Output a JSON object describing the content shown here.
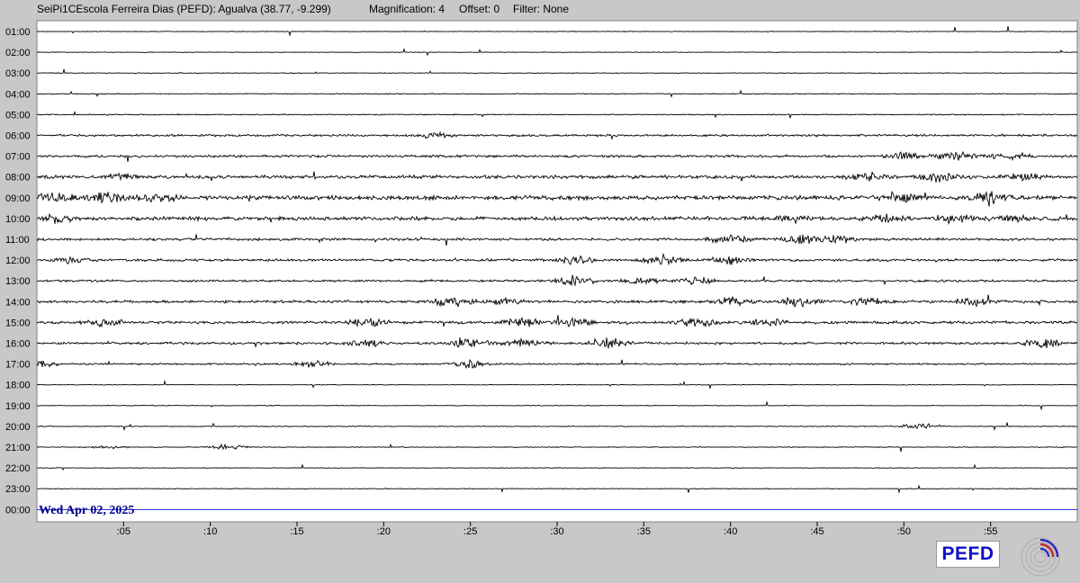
{
  "header": {
    "station": "SeiPi1CEscola Ferreira Dias (PEFD):  Agualva (38.77, -9.299)",
    "magnification": "Magnification: 4",
    "offset": "Offset: 0",
    "filter": "Filter: None"
  },
  "date_label": "Wed Apr 02, 2025",
  "logo": {
    "text": "PEFD",
    "icon": "seismograph-logo-icon",
    "color": "#1010c8"
  },
  "colors": {
    "background": "#c8c8c8",
    "plot": "#ffffff",
    "trace": "#000000",
    "last_trace": "#0000cc",
    "date": "#00008b"
  },
  "chart_data": {
    "type": "helicorder",
    "hours": [
      "01:00",
      "02:00",
      "03:00",
      "04:00",
      "05:00",
      "06:00",
      "07:00",
      "08:00",
      "09:00",
      "10:00",
      "11:00",
      "12:00",
      "13:00",
      "14:00",
      "15:00",
      "16:00",
      "17:00",
      "18:00",
      "19:00",
      "20:00",
      "21:00",
      "22:00",
      "23:00",
      "00:00"
    ],
    "minute_ticks": [
      ":05",
      ":10",
      ":15",
      ":20",
      ":25",
      ":30",
      ":35",
      ":40",
      ":45",
      ":50",
      ":55"
    ],
    "minute_tick_values": [
      5,
      10,
      15,
      20,
      25,
      30,
      35,
      40,
      45,
      50,
      55
    ],
    "xlim": [
      0,
      60
    ],
    "activity": [
      {
        "hour": "01:00",
        "base": 0.3,
        "bursts": []
      },
      {
        "hour": "02:00",
        "base": 0.3,
        "bursts": []
      },
      {
        "hour": "03:00",
        "base": 0.3,
        "bursts": []
      },
      {
        "hour": "04:00",
        "base": 0.4,
        "bursts": []
      },
      {
        "hour": "05:00",
        "base": 0.5,
        "bursts": []
      },
      {
        "hour": "06:00",
        "base": 1.0,
        "bursts": [
          [
            23,
            3
          ]
        ]
      },
      {
        "hour": "07:00",
        "base": 1.2,
        "bursts": [
          [
            50,
            4
          ],
          [
            53,
            5
          ],
          [
            56,
            4
          ]
        ]
      },
      {
        "hour": "08:00",
        "base": 1.6,
        "bursts": [
          [
            5,
            3
          ],
          [
            48,
            4
          ],
          [
            52,
            5
          ],
          [
            57,
            4
          ]
        ]
      },
      {
        "hour": "09:00",
        "base": 2.0,
        "bursts": [
          [
            1,
            6
          ],
          [
            4,
            6
          ],
          [
            7,
            5
          ],
          [
            50,
            5
          ],
          [
            55,
            6
          ]
        ]
      },
      {
        "hour": "10:00",
        "base": 1.8,
        "bursts": [
          [
            1,
            5
          ],
          [
            44,
            4
          ],
          [
            49,
            5
          ],
          [
            53,
            5
          ],
          [
            56,
            4
          ]
        ]
      },
      {
        "hour": "11:00",
        "base": 1.2,
        "bursts": [
          [
            40,
            4
          ],
          [
            44,
            5
          ],
          [
            46,
            4
          ]
        ]
      },
      {
        "hour": "12:00",
        "base": 1.2,
        "bursts": [
          [
            2,
            3
          ],
          [
            31,
            5
          ],
          [
            36,
            5
          ],
          [
            40,
            4
          ]
        ]
      },
      {
        "hour": "13:00",
        "base": 1.0,
        "bursts": [
          [
            31,
            5
          ],
          [
            35,
            4
          ],
          [
            38,
            4
          ]
        ]
      },
      {
        "hour": "14:00",
        "base": 1.3,
        "bursts": [
          [
            24,
            5
          ],
          [
            27,
            4
          ],
          [
            40,
            5
          ],
          [
            44,
            5
          ],
          [
            48,
            4
          ],
          [
            54,
            5
          ]
        ]
      },
      {
        "hour": "15:00",
        "base": 1.3,
        "bursts": [
          [
            4,
            4
          ],
          [
            19,
            5
          ],
          [
            28,
            5
          ],
          [
            31,
            5
          ],
          [
            38,
            5
          ],
          [
            42,
            5
          ]
        ]
      },
      {
        "hour": "16:00",
        "base": 1.2,
        "bursts": [
          [
            19,
            4
          ],
          [
            25,
            5
          ],
          [
            28,
            4
          ],
          [
            33,
            6
          ],
          [
            58,
            5
          ]
        ]
      },
      {
        "hour": "17:00",
        "base": 0.8,
        "bursts": [
          [
            0,
            4
          ],
          [
            16,
            3
          ],
          [
            25,
            4
          ]
        ]
      },
      {
        "hour": "18:00",
        "base": 0.3,
        "bursts": []
      },
      {
        "hour": "19:00",
        "base": 0.3,
        "bursts": []
      },
      {
        "hour": "20:00",
        "base": 0.4,
        "bursts": [
          [
            51,
            3
          ]
        ]
      },
      {
        "hour": "21:00",
        "base": 0.4,
        "bursts": [
          [
            4,
            2
          ],
          [
            11,
            3
          ]
        ]
      },
      {
        "hour": "22:00",
        "base": 0.3,
        "bursts": []
      },
      {
        "hour": "23:00",
        "base": 0.3,
        "bursts": []
      },
      {
        "hour": "00:00",
        "base": 0.0,
        "bursts": []
      }
    ]
  }
}
